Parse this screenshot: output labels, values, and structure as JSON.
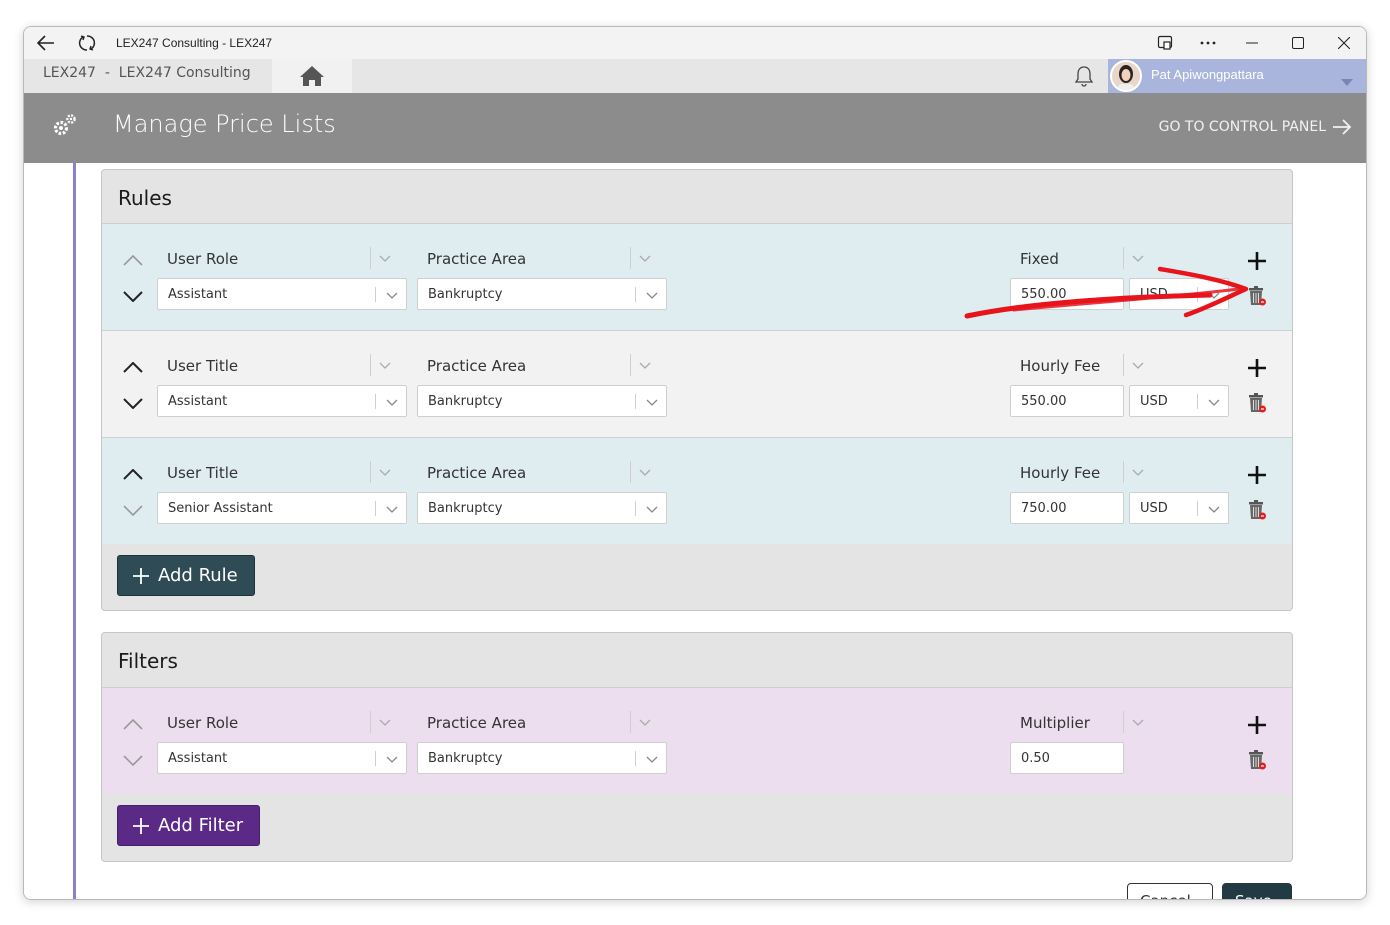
{
  "window": {
    "title": "LEX247 Consulting - LEX247"
  },
  "topbar": {
    "breadcrumb": "LEX247  -  LEX247 Consulting",
    "user_name": "Pat Apiwongpattara"
  },
  "header": {
    "title": "Manage Price Lists",
    "control_panel_link": "GO TO CONTROL PANEL"
  },
  "rules": {
    "title": "Rules",
    "add_label": "Add Rule",
    "rows": [
      {
        "type_label": "User Role",
        "type_value": "Assistant",
        "area_label": "Practice Area",
        "area_value": "Bankruptcy",
        "fee_label": "Fixed",
        "fee_value": "550.00",
        "currency": "USD"
      },
      {
        "type_label": "User Title",
        "type_value": "Assistant",
        "area_label": "Practice Area",
        "area_value": "Bankruptcy",
        "fee_label": "Hourly Fee",
        "fee_value": "550.00",
        "currency": "USD"
      },
      {
        "type_label": "User Title",
        "type_value": "Senior Assistant",
        "area_label": "Practice Area",
        "area_value": "Bankruptcy",
        "fee_label": "Hourly Fee",
        "fee_value": "750.00",
        "currency": "USD"
      }
    ]
  },
  "filters": {
    "title": "Filters",
    "add_label": "Add Filter",
    "rows": [
      {
        "type_label": "User Role",
        "type_value": "Assistant",
        "area_label": "Practice Area",
        "area_value": "Bankruptcy",
        "fee_label": "Multiplier",
        "fee_value": "0.50"
      }
    ]
  },
  "footer": {
    "cancel_label": "Cancel",
    "save_label": "Save"
  },
  "colors": {
    "header_bg": "#8c8c8c",
    "rule_button": "#2f4b56",
    "filter_button": "#5a2a86",
    "annotation": "#e8141c"
  }
}
